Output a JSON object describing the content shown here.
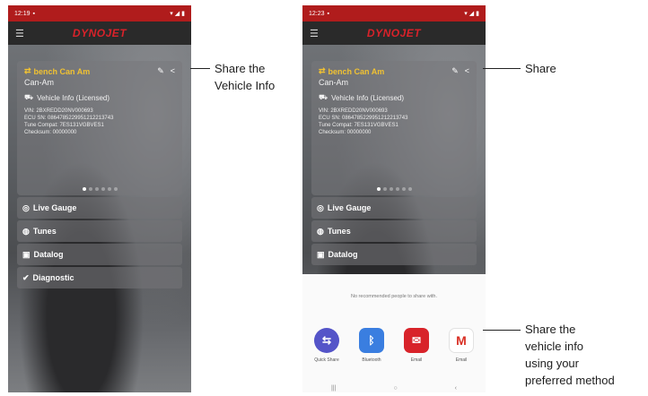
{
  "accent": "#d9222a",
  "status_bar_color": "#b01c1c",
  "left_phone": {
    "time": "12:19",
    "app_logo": "DYNOJET",
    "vehicle_name": "bench Can Am",
    "vehicle_make": "Can-Am",
    "vehicle_info_label": "Vehicle Info (Licensed)",
    "vin": "VIN: 2BXREDD20NV000693",
    "ecu_sn": "ECU SN: 0864785229951212213743",
    "tune_compat": "Tune Compat: 7ES131VGBVES1",
    "checksum": "Checksum: 00000000",
    "menu": [
      "Live Gauge",
      "Tunes",
      "Datalog",
      "Diagnostic"
    ]
  },
  "right_phone": {
    "time": "12:23",
    "app_logo": "DYNOJET",
    "vehicle_name": "bench Can Am",
    "vehicle_make": "Can-Am",
    "vehicle_info_label": "Vehicle Info (Licensed)",
    "vin": "VIN: 2BXREDD20NV000693",
    "ecu_sn": "ECU SN: 0864785229951212213743",
    "tune_compat": "Tune Compat: 7ES131VGBVES1",
    "checksum": "Checksum: 00000000",
    "menu": [
      "Live Gauge",
      "Tunes",
      "Datalog"
    ],
    "share_sheet": {
      "no_recommendations": "No recommended people to share with.",
      "apps": [
        "Quick Share",
        "Bluetooth",
        "Email",
        "Email"
      ]
    }
  },
  "callouts": {
    "share_vehicle_info": [
      "Share the",
      "Vehicle Info"
    ],
    "share": "Share",
    "share_method": [
      "Share the",
      "vehicle info",
      "using your",
      "preferred method"
    ]
  }
}
